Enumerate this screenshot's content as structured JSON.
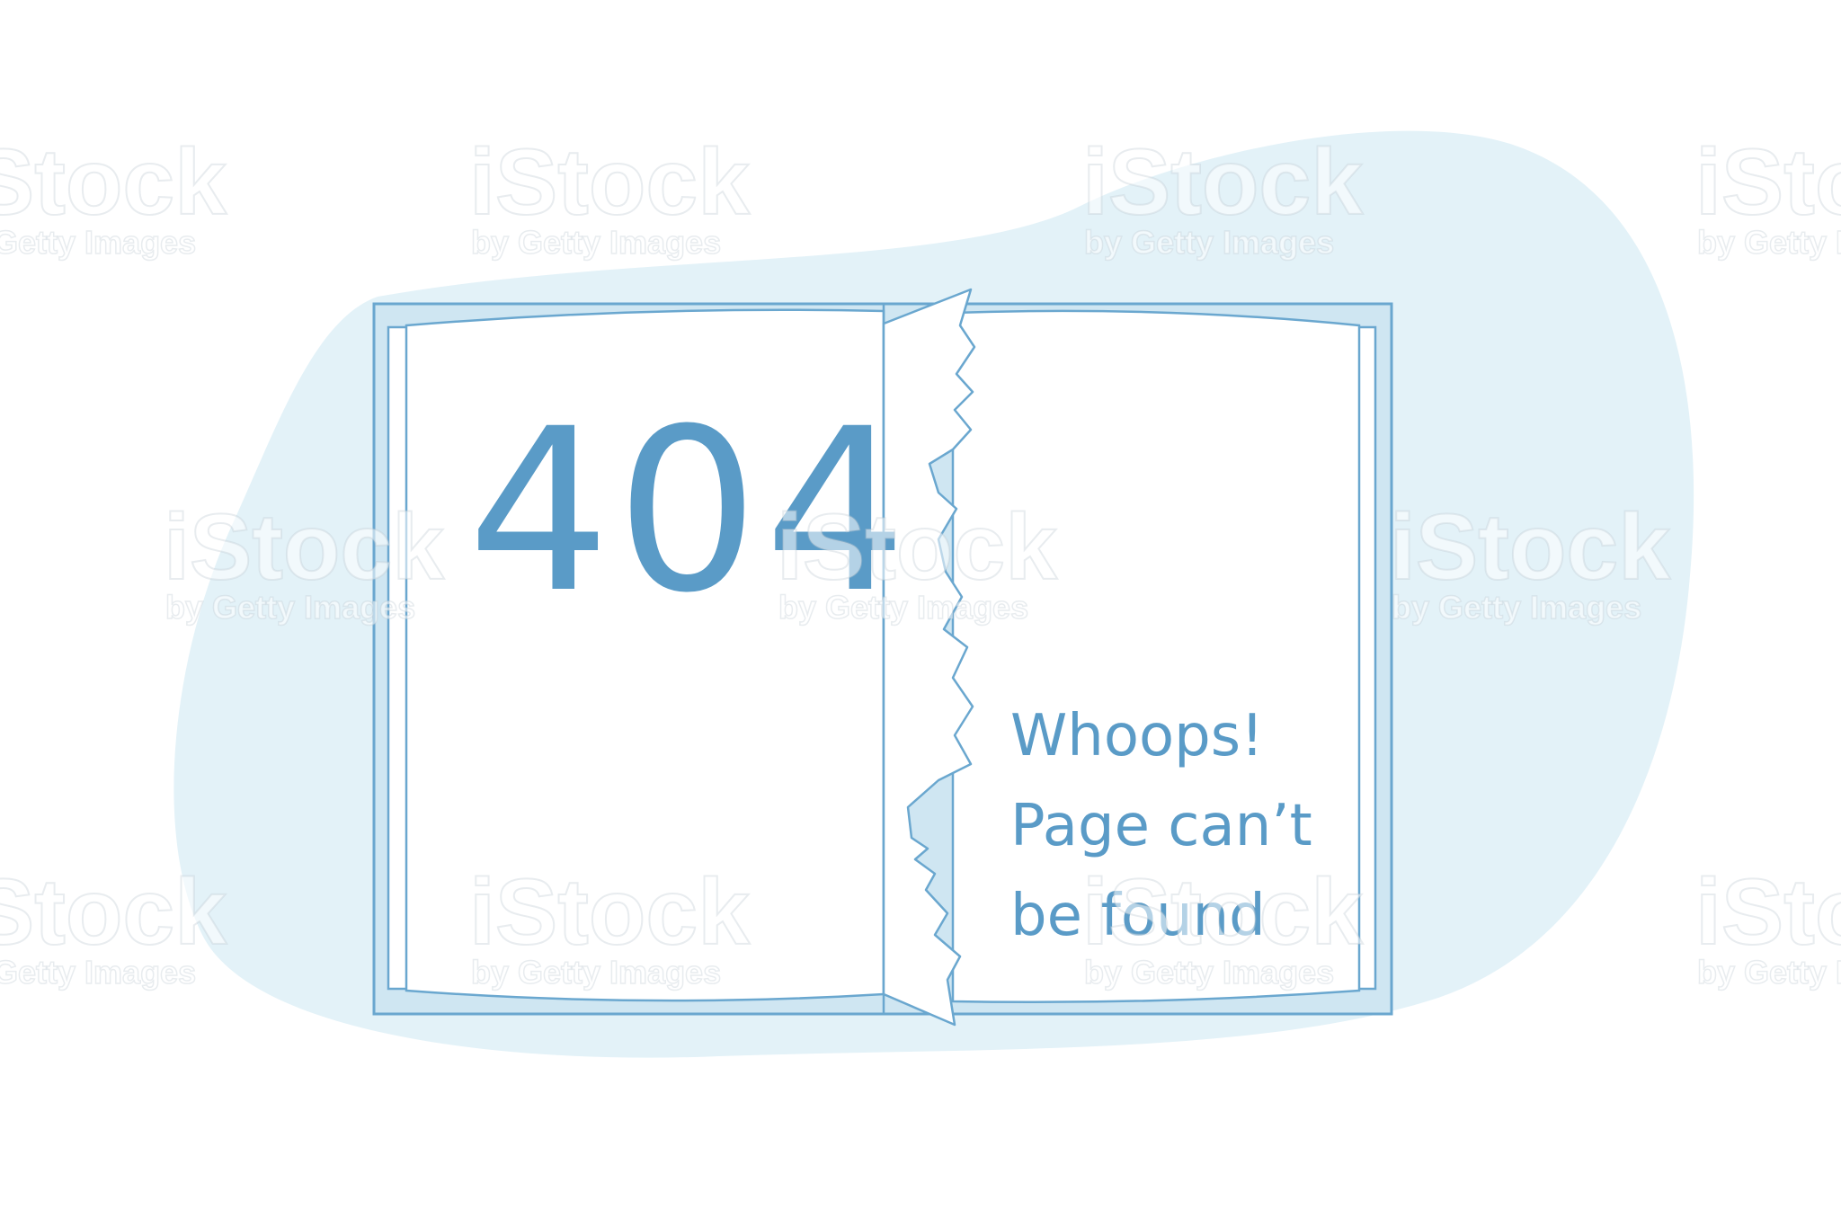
{
  "error": {
    "code": "404",
    "message_lines": [
      "Whoops!",
      "Page can’t",
      "be found"
    ]
  },
  "watermark": {
    "brand": "iStock",
    "byline": "by Getty Images"
  },
  "colors": {
    "accent": "#5a9bc7",
    "blob": "#e3f2f8",
    "cover": "#cfe6f2",
    "page": "#ffffff",
    "line": "#6aa7cf"
  }
}
